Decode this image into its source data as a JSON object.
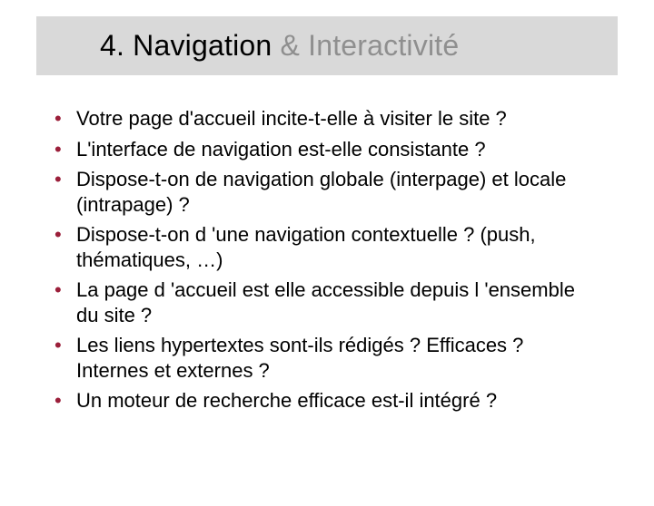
{
  "title": {
    "dark": "4. Navigation ",
    "light": "& Interactivité"
  },
  "bullets": [
    "Votre page d'accueil incite-t-elle à visiter le site ?",
    "L'interface de navigation est-elle consistante ?",
    "Dispose-t-on de navigation globale (interpage) et locale (intrapage) ?",
    "Dispose-t-on d 'une navigation contextuelle ? (push, thématiques, …)",
    "La page d 'accueil est elle accessible depuis l 'ensemble du site ?",
    "Les liens hypertextes sont-ils rédigés ? Efficaces ? Internes et externes ?",
    "Un moteur de recherche efficace est-il intégré ?"
  ]
}
